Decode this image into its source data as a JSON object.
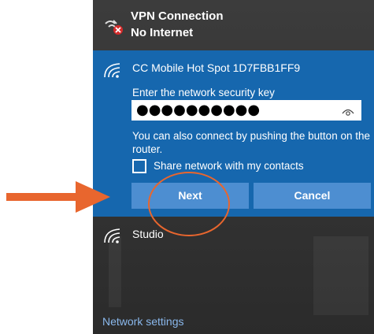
{
  "vpn": {
    "name": "VPN Connection",
    "status": "No Internet"
  },
  "wifi_panel": {
    "ssid": "CC Mobile Hot Spot 1D7FBB1FF9",
    "key_label": "Enter the network security key",
    "key_value": "●●●●●●●●●●",
    "push_hint": "You can also connect by pushing the button on the router.",
    "share_label": "Share network with my contacts",
    "share_checked": false,
    "next_label": "Next",
    "cancel_label": "Cancel"
  },
  "other_networks": [
    {
      "name": "Studio"
    }
  ],
  "footer": {
    "network_settings_label": "Network settings"
  },
  "colors": {
    "panel_bg": "#1667ae",
    "button_bg": "#4d8ed1",
    "flyout_bg": "#3a3a3a",
    "annotation": "#e8662e",
    "link": "#8ab8ec"
  },
  "icons": {
    "vpn": "vpn-disconnected-icon",
    "wifi": "wifi-signal-icon",
    "reveal": "eye-reveal-icon"
  }
}
